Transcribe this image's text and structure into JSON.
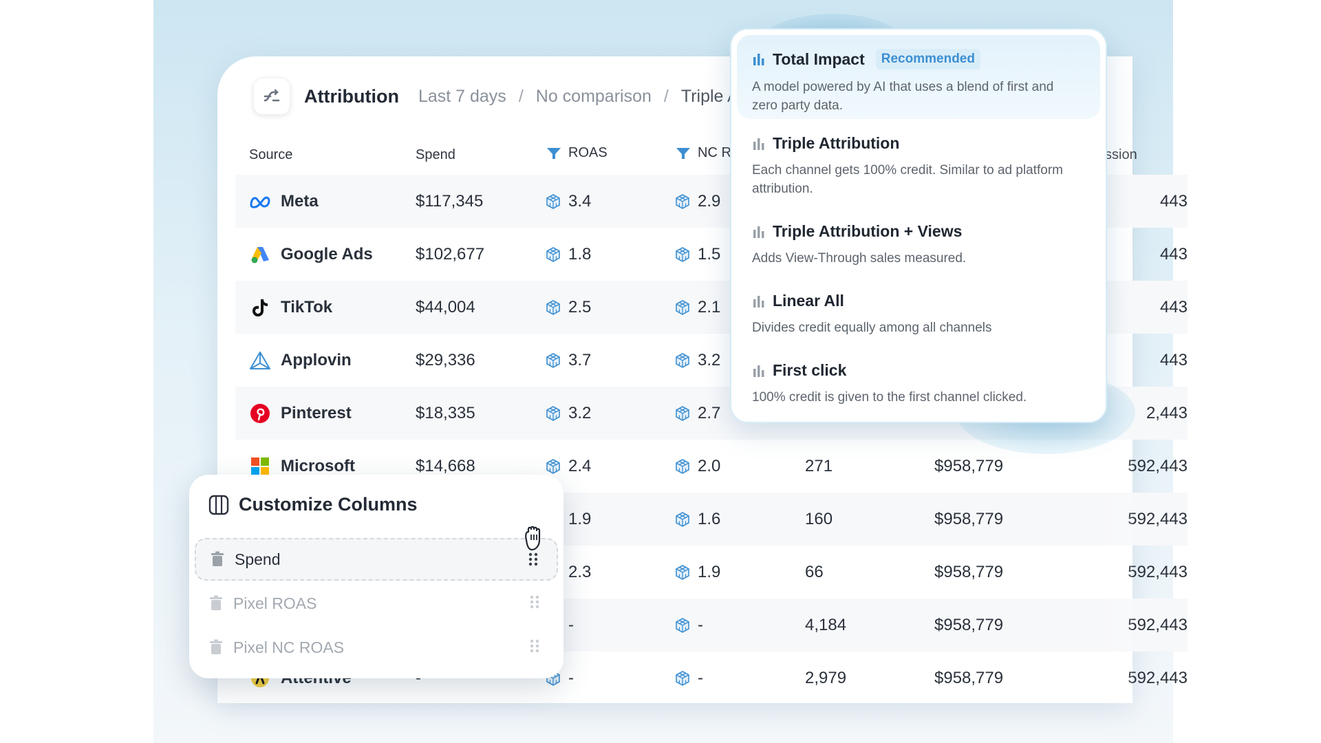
{
  "header": {
    "title": "Attribution",
    "breadcrumbs": [
      "Last 7 days",
      "No comparison",
      "Triple A"
    ],
    "separator": "/"
  },
  "table": {
    "columns": [
      "Source",
      "Spend",
      "ROAS",
      "NC R",
      "",
      "",
      "ssion"
    ],
    "rows": [
      {
        "source": "Meta",
        "icon": "meta-icon",
        "spend": "$117,345",
        "roas": "3.4",
        "ncroas": "2.9",
        "c5": "",
        "c6": "",
        "c7": "443"
      },
      {
        "source": "Google Ads",
        "icon": "google-ads-icon",
        "spend": "$102,677",
        "roas": "1.8",
        "ncroas": "1.5",
        "c5": "",
        "c6": "",
        "c7": "443"
      },
      {
        "source": "TikTok",
        "icon": "tiktok-icon",
        "spend": "$44,004",
        "roas": "2.5",
        "ncroas": "2.1",
        "c5": "",
        "c6": "",
        "c7": "443"
      },
      {
        "source": "Applovin",
        "icon": "applovin-icon",
        "spend": "$29,336",
        "roas": "3.7",
        "ncroas": "3.2",
        "c5": "",
        "c6": "",
        "c7": "443"
      },
      {
        "source": "Pinterest",
        "icon": "pinterest-icon",
        "spend": "$18,335",
        "roas": "3.2",
        "ncroas": "2.7",
        "c5": "",
        "c6": "",
        "c7": "2,443"
      },
      {
        "source": "Microsoft",
        "icon": "microsoft-icon",
        "spend": "$14,668",
        "roas": "2.4",
        "ncroas": "2.0",
        "c5": "271",
        "c6": "$958,779",
        "c7": "592,443"
      },
      {
        "source": "",
        "icon": "",
        "spend": "",
        "roas": "1.9",
        "ncroas": "1.6",
        "c5": "160",
        "c6": "$958,779",
        "c7": "592,443"
      },
      {
        "source": "",
        "icon": "",
        "spend": "",
        "roas": "2.3",
        "ncroas": "1.9",
        "c5": "66",
        "c6": "$958,779",
        "c7": "592,443"
      },
      {
        "source": "",
        "icon": "",
        "spend": "",
        "roas": "-",
        "ncroas": "-",
        "c5": "4,184",
        "c6": "$958,779",
        "c7": "592,443"
      },
      {
        "source": "Attentive",
        "icon": "attentive-icon",
        "spend": "-",
        "roas": "-",
        "ncroas": "-",
        "c5": "2,979",
        "c6": "$958,779",
        "c7": "592,443"
      }
    ]
  },
  "attribution_menu": {
    "items": [
      {
        "title": "Total Impact",
        "badge": "Recommended",
        "desc": "A model powered by AI that uses a blend of first and zero party data."
      },
      {
        "title": "Triple Attribution",
        "desc": "Each channel gets 100% credit. Similar to ad platform attribution."
      },
      {
        "title": "Triple Attribution + Views",
        "desc": "Adds View-Through sales measured."
      },
      {
        "title": "Linear All",
        "desc": "Divides credit equally among all channels"
      },
      {
        "title": "First click",
        "desc": "100% credit is given to the first channel clicked."
      }
    ]
  },
  "customize_columns": {
    "title": "Customize Columns",
    "items": [
      "Spend",
      "Pixel ROAS",
      "Pixel NC ROAS"
    ]
  },
  "colors": {
    "accent": "#3d8fd1",
    "badge_bg": "#d9edf9",
    "stage_bg": "#cde6f2"
  }
}
